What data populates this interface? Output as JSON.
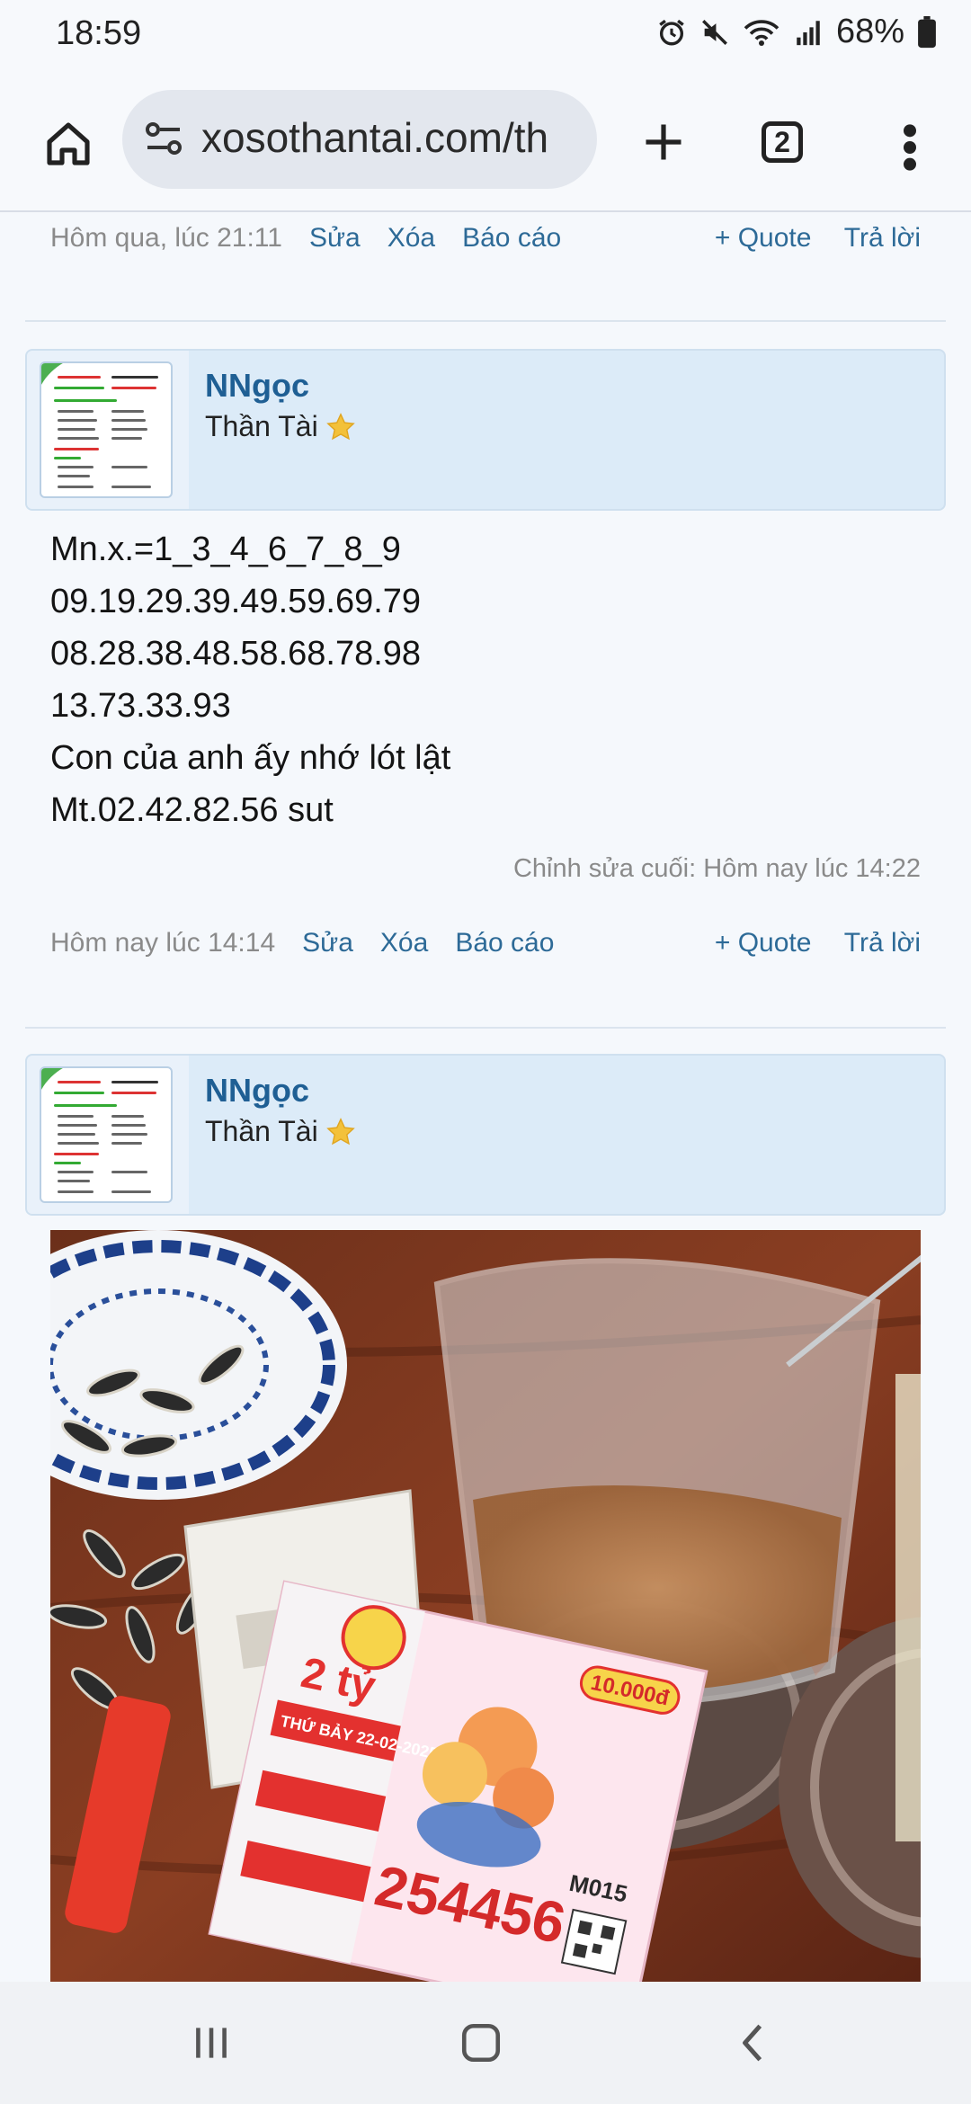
{
  "status_bar": {
    "time": "18:59",
    "battery_percent": "68%"
  },
  "browser": {
    "url": "xosothantai.com/th",
    "tab_count": "2"
  },
  "prev_post_actions": {
    "timestamp": "Hôm qua, lúc 21:11",
    "edit": "Sửa",
    "delete": "Xóa",
    "report": "Báo cáo",
    "quote": "+ Quote",
    "reply": "Trả lời"
  },
  "post1": {
    "username": "NNgọc",
    "user_title": "Thần Tài",
    "lines": [
      "Mn.x.=1_3_4_6_7_8_9",
      "09.19.29.39.49.59.69.79",
      "08.28.38.48.58.68.78.98",
      "13.73.33.93",
      "Con của anh ấy nhớ lót lật",
      "Mt.02.42.82.56 sut"
    ],
    "edited_note": "Chỉnh sửa cuối: Hôm nay lúc 14:22",
    "timestamp": "Hôm nay lúc 14:14",
    "edit": "Sửa",
    "delete": "Xóa",
    "report": "Báo cáo",
    "quote": "+ Quote",
    "reply": "Trả lời"
  },
  "post2": {
    "username": "NNgọc",
    "user_title": "Thần Tài",
    "photo_texts": {
      "price": "10.000đ",
      "prize": "2 tỷ",
      "draw_date": "THỨ BẢY 22-02-2025",
      "ticket_number": "254456",
      "series": "M015"
    }
  },
  "colors": {
    "link": "#2d6a97",
    "username": "#1f5f94",
    "header_bg": "#dcebf8"
  }
}
